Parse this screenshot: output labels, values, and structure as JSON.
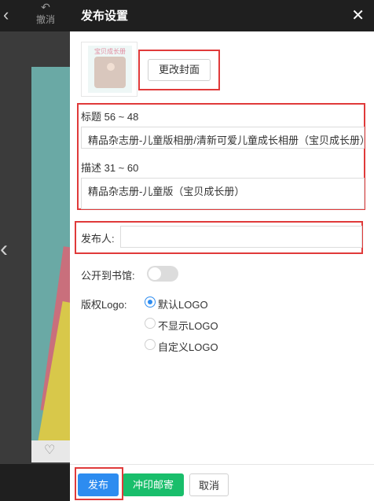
{
  "editor": {
    "undo_label": "撤消"
  },
  "dialog": {
    "title": "发布设置",
    "change_cover_label": "更改封面",
    "thumbnail_text": "宝贝成长册",
    "title_label": "标题 56 ~ 48",
    "title_value": "精品杂志册-儿童版相册/清新可爱儿童成长相册（宝贝成长册）",
    "desc_label": "描述 31 ~ 60",
    "desc_value": "精品杂志册-儿童版（宝贝成长册）",
    "publisher_label": "发布人:",
    "publisher_value": "",
    "public_label": "公开到书馆:",
    "public_on": false,
    "logo_label": "版权Logo:",
    "logo_options": [
      {
        "label": "默认LOGO",
        "checked": true
      },
      {
        "label": "不显示LOGO",
        "checked": false
      },
      {
        "label": "自定义LOGO",
        "checked": false
      }
    ],
    "publish_label": "发布",
    "print_label": "冲印邮寄",
    "cancel_label": "取消"
  },
  "colors": {
    "primary": "#2d8cf0",
    "success": "#19be6b",
    "highlight": "#e03a3a"
  }
}
